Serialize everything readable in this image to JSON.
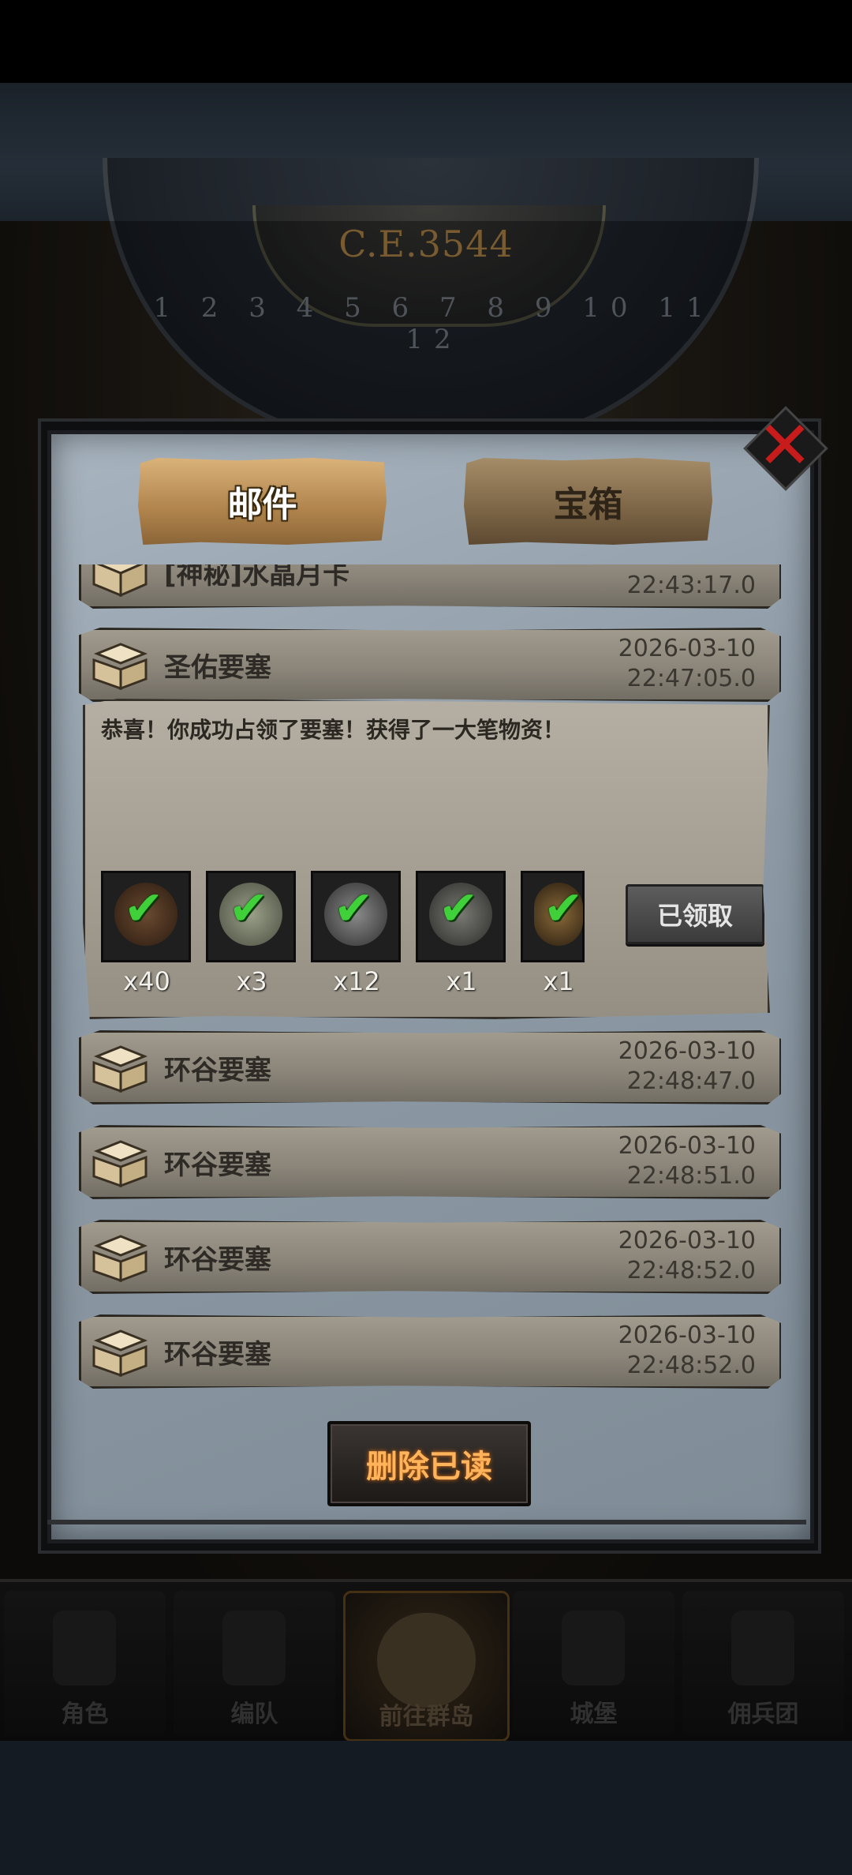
{
  "scene": {
    "era": "C.E.3544",
    "dial_numbers": "1 2 3 4 5 6 7 8 9 10 11 12"
  },
  "tabs": {
    "mail": "邮件",
    "chest": "宝箱"
  },
  "mails": [
    {
      "title": "[神秘]水晶月卡",
      "date": "",
      "time": "22:43:17.0"
    },
    {
      "title": "圣佑要塞",
      "date": "2026-03-10",
      "time": "22:47:05.0",
      "body": "恭喜！你成功占领了要塞！获得了一大笔物资！",
      "items": [
        {
          "icon": "goblet-icon",
          "qty": "x40"
        },
        {
          "icon": "stone-icon",
          "qty": "x3"
        },
        {
          "icon": "ore-icon",
          "qty": "x12"
        },
        {
          "icon": "rock-icon",
          "qty": "x1"
        },
        {
          "icon": "medallion-icon",
          "qty": "x1"
        }
      ],
      "claim_label": "已领取"
    },
    {
      "title": "环谷要塞",
      "date": "2026-03-10",
      "time": "22:48:47.0"
    },
    {
      "title": "环谷要塞",
      "date": "2026-03-10",
      "time": "22:48:51.0"
    },
    {
      "title": "环谷要塞",
      "date": "2026-03-10",
      "time": "22:48:52.0"
    },
    {
      "title": "环谷要塞",
      "date": "2026-03-10",
      "time": "22:48:52.0"
    }
  ],
  "delete_read_label": "删除已读",
  "nav": [
    {
      "label": "角色"
    },
    {
      "label": "编队"
    },
    {
      "label": "前往群岛"
    },
    {
      "label": "城堡"
    },
    {
      "label": "佣兵团"
    }
  ],
  "colors": {
    "accent_gold": "#d9b27a",
    "check_green": "#3fd03a",
    "close_red": "#c81c1c",
    "delete_text": "#ffb35a"
  }
}
